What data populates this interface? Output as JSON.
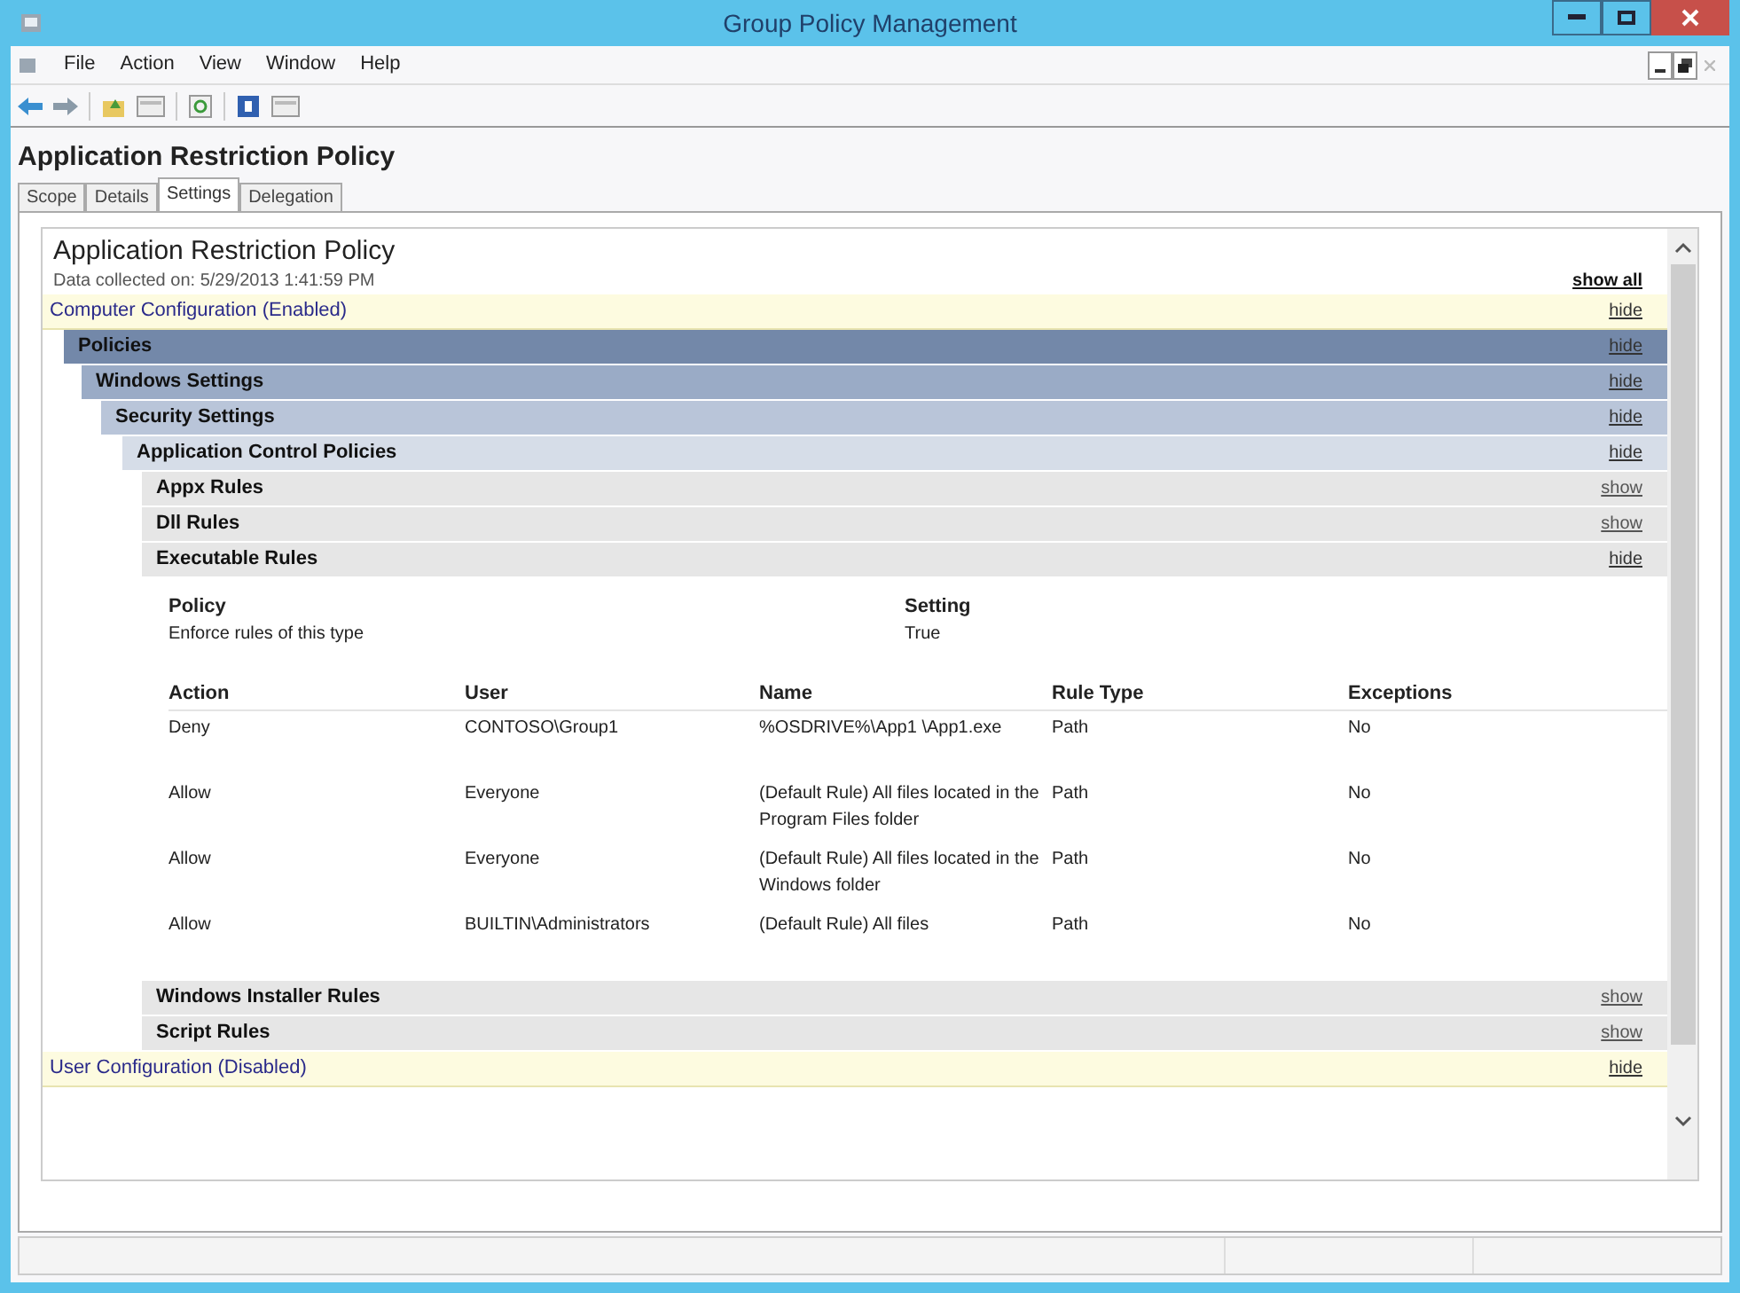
{
  "window": {
    "title": "Group Policy Management"
  },
  "menu": [
    "File",
    "Action",
    "View",
    "Window",
    "Help"
  ],
  "header": {
    "title": "Application Restriction Policy"
  },
  "tabs": [
    {
      "label": "Scope",
      "selected": false
    },
    {
      "label": "Details",
      "selected": false
    },
    {
      "label": "Settings",
      "selected": true
    },
    {
      "label": "Delegation",
      "selected": false
    }
  ],
  "report": {
    "title": "Application Restriction Policy",
    "collected": "Data collected on: 5/29/2013 1:41:59 PM",
    "show_all": "show all",
    "sections": [
      {
        "kind": "config",
        "title": "Computer Configuration (Enabled)",
        "toggle": "hide",
        "expanded": true,
        "children": [
          {
            "kind": "heading",
            "title": "Policies",
            "toggle": "hide",
            "expanded": true,
            "children": [
              {
                "kind": "heading",
                "title": "Windows Settings",
                "toggle": "hide",
                "expanded": true,
                "children": [
                  {
                    "kind": "heading",
                    "title": "Security Settings",
                    "toggle": "hide",
                    "expanded": true,
                    "children": [
                      {
                        "kind": "heading",
                        "title": "Application Control Policies",
                        "toggle": "hide",
                        "expanded": true,
                        "children": [
                          {
                            "kind": "heading",
                            "title": "Appx Rules",
                            "toggle": "show",
                            "expanded": false
                          },
                          {
                            "kind": "heading",
                            "title": "Dll Rules",
                            "toggle": "show",
                            "expanded": false
                          },
                          {
                            "kind": "heading",
                            "title": "Executable Rules",
                            "toggle": "hide",
                            "expanded": true,
                            "content": {
                              "policy_table": {
                                "columns": [
                                  "Policy",
                                  "Setting"
                                ],
                                "rows": [
                                  [
                                    "Enforce rules of this type",
                                    "True"
                                  ]
                                ]
                              },
                              "rules_table": {
                                "columns": [
                                  "Action",
                                  "User",
                                  "Name",
                                  "Rule Type",
                                  "Exceptions"
                                ],
                                "rows": [
                                  [
                                    "Deny",
                                    "CONTOSO\\Group1",
                                    "%OSDRIVE%\\App1 \\App1.exe",
                                    "Path",
                                    "No"
                                  ],
                                  [
                                    "Allow",
                                    "Everyone",
                                    "(Default Rule) All files located in the Program Files folder",
                                    "Path",
                                    "No"
                                  ],
                                  [
                                    "Allow",
                                    "Everyone",
                                    "(Default Rule) All files located in the Windows folder",
                                    "Path",
                                    "No"
                                  ],
                                  [
                                    "Allow",
                                    "BUILTIN\\Administrators",
                                    "(Default Rule) All files",
                                    "Path",
                                    "No"
                                  ]
                                ]
                              }
                            }
                          },
                          {
                            "kind": "heading",
                            "title": "Windows Installer Rules",
                            "toggle": "show",
                            "expanded": false
                          },
                          {
                            "kind": "heading",
                            "title": "Script Rules",
                            "toggle": "show",
                            "expanded": false
                          }
                        ]
                      }
                    ]
                  }
                ]
              }
            ]
          }
        ]
      },
      {
        "kind": "config",
        "title": "User Configuration (Disabled)",
        "toggle": "hide",
        "expanded": true
      }
    ]
  }
}
